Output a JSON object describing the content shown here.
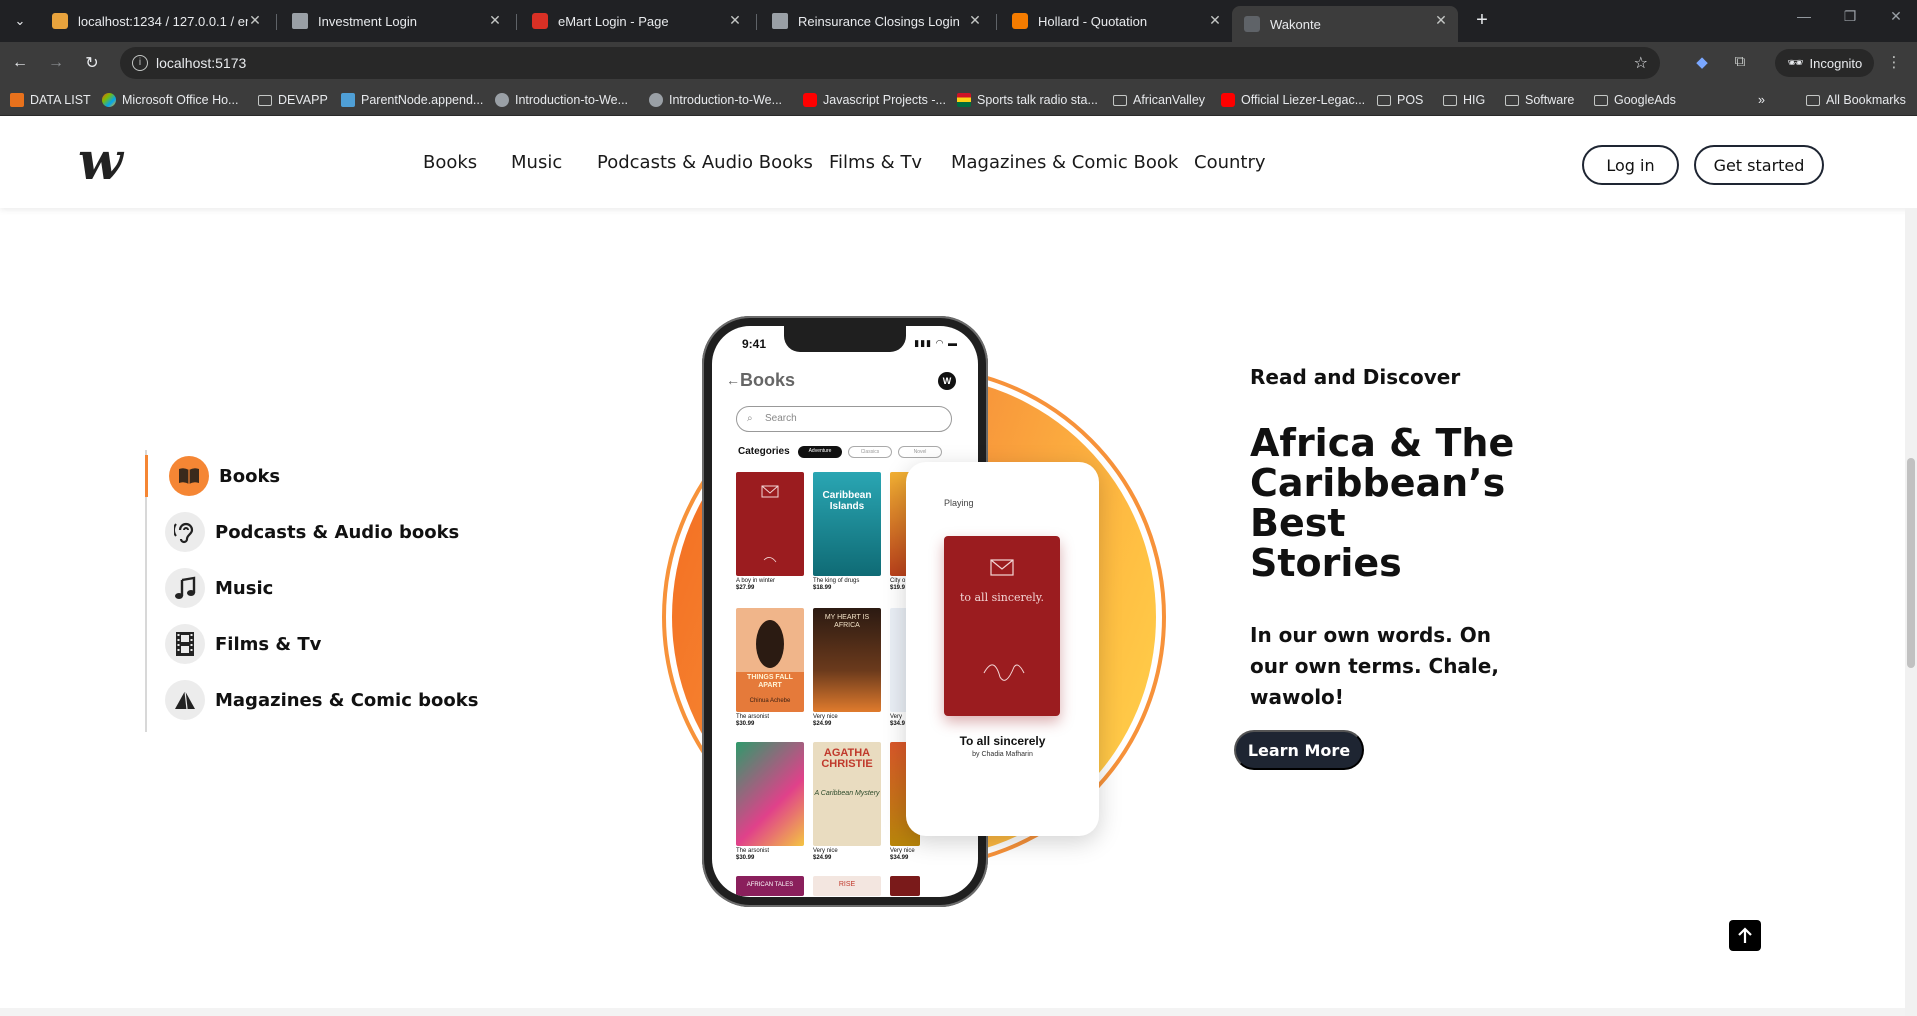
{
  "browser": {
    "tabs": [
      {
        "title": "localhost:1234 / 127.0.0.1 / em",
        "favicon_color": "#e8a33d"
      },
      {
        "title": "Investment Login",
        "favicon_color": "#9aa0a6"
      },
      {
        "title": "eMart Login - Page",
        "favicon_color": "#d93025"
      },
      {
        "title": "Reinsurance Closings Login",
        "favicon_color": "#9aa0a6"
      },
      {
        "title": "Hollard - Quotation",
        "favicon_color": "#f57c00"
      },
      {
        "title": "Wakonte",
        "favicon_color": "#5f6368"
      }
    ],
    "address": "localhost:5173",
    "incognito_label": "Incognito",
    "bookmarks": [
      {
        "label": "DATA LIST",
        "icon": "orange"
      },
      {
        "label": "Microsoft Office Ho...",
        "icon": "office"
      },
      {
        "label": "DEVAPP",
        "icon": "folder"
      },
      {
        "label": "ParentNode.append...",
        "icon": "blue"
      },
      {
        "label": "Introduction-to-We...",
        "icon": "github"
      },
      {
        "label": "Introduction-to-We...",
        "icon": "github"
      },
      {
        "label": "Javascript Projects -...",
        "icon": "youtube"
      },
      {
        "label": "Sports talk radio sta...",
        "icon": "flag"
      },
      {
        "label": "AfricanValley",
        "icon": "folder"
      },
      {
        "label": "Official Liezer-Legac...",
        "icon": "youtube"
      },
      {
        "label": "POS",
        "icon": "folder"
      },
      {
        "label": "HIG",
        "icon": "folder"
      },
      {
        "label": "Software",
        "icon": "folder"
      },
      {
        "label": "GoogleAds",
        "icon": "folder"
      }
    ],
    "all_bookmarks": "All Bookmarks"
  },
  "site": {
    "logo": "w",
    "nav": [
      "Books",
      "Music",
      "Podcasts & Audio Books",
      "Films & Tv",
      "Magazines & Comic Book",
      "Country"
    ],
    "login_label": "Log in",
    "get_started_label": "Get started"
  },
  "sidebar": {
    "items": [
      {
        "label": "Books",
        "icon": "book-open-icon",
        "active": true
      },
      {
        "label": "Podcasts & Audio books",
        "icon": "ear-icon",
        "active": false
      },
      {
        "label": "Music",
        "icon": "music-note-icon",
        "active": false
      },
      {
        "label": "Films & Tv",
        "icon": "film-strip-icon",
        "active": false
      },
      {
        "label": "Magazines & Comic books",
        "icon": "magazine-icon",
        "active": false
      }
    ]
  },
  "phone": {
    "time": "9:41",
    "title": "Books",
    "avatar": "W",
    "search_placeholder": "Search",
    "categories_label": "Categories",
    "chips": [
      "Adventure",
      "Classics",
      "Novel"
    ],
    "books": [
      {
        "caption": "A boy in winter",
        "price": "$27.99",
        "color": "#9b1c1f"
      },
      {
        "caption": "The king of drugs",
        "price": "$18.99",
        "color": "#1d8a96"
      },
      {
        "caption": "City o",
        "price": "$19.9",
        "color": "#c0571d"
      },
      {
        "caption": "The arsonist",
        "price": "$30.99",
        "color": "#e8a16b"
      },
      {
        "caption": "Very nice",
        "price": "$24.99",
        "color": "#3b2618"
      },
      {
        "caption": "Very",
        "price": "$34.9",
        "color": "#2b5a8f"
      },
      {
        "caption": "The arsonist",
        "price": "$30.99",
        "color": "#2f9a6b"
      },
      {
        "caption": "Very nice",
        "price": "$24.99",
        "color": "#e9dcc0"
      },
      {
        "caption": "Very nice",
        "price": "$34.99",
        "color": "#d9572a"
      }
    ],
    "cover_texts": [
      "Caribbean Islands",
      "THINGS FALL APART",
      "MY HEART IS AFRICA",
      "AGATHA CHRISTIE",
      "A Caribbean Mystery",
      "Chinua Achebe",
      "AFRICAN TALES",
      "RISE"
    ]
  },
  "player": {
    "label": "Playing",
    "cover_title": "to all sincerely.",
    "title": "To all sincerely",
    "author": "by Chadia Mafharin"
  },
  "hero": {
    "eyebrow": "Read and Discover",
    "title_lines": [
      "Africa & The",
      "Caribbean’s",
      "Best",
      "Stories"
    ],
    "subtitle": "In our own words. On our own terms. Chale, wawolo!",
    "cta": "Learn More"
  },
  "colors": {
    "accent": "#f58634",
    "dark_button": "#1e2532"
  }
}
